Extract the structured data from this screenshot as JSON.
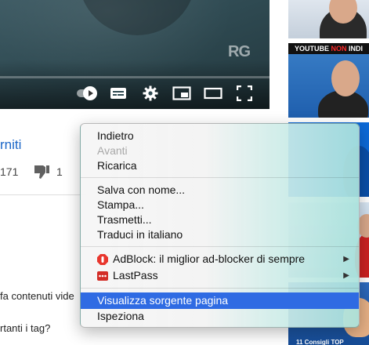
{
  "player": {
    "watermark": "RG",
    "controls": [
      "autoplay-toggle",
      "subtitles-icon",
      "settings-gear-icon",
      "miniplayer-icon",
      "theater-mode-icon",
      "fullscreen-icon"
    ]
  },
  "video": {
    "title_fragment": "rniti",
    "likes": "171",
    "dislikes": "1",
    "description_line1": "fa contenuti vide",
    "description_line2": "rtanti i tag?"
  },
  "sidebar": {
    "thumb2_banner_white1": "YOUTUBE ",
    "thumb2_banner_red": "NON",
    "thumb2_banner_white2": " INDI",
    "thumb5_caption": "11 Consigli TOP"
  },
  "context_menu": {
    "items": [
      {
        "label": "Indietro",
        "enabled": true
      },
      {
        "label": "Avanti",
        "enabled": false
      },
      {
        "label": "Ricarica",
        "enabled": true
      },
      {
        "label": "Salva con nome...",
        "enabled": true
      },
      {
        "label": "Stampa...",
        "enabled": true
      },
      {
        "label": "Trasmetti...",
        "enabled": true
      },
      {
        "label": "Traduci in italiano",
        "enabled": true
      },
      {
        "label": "AdBlock: il miglior ad-blocker di sempre",
        "enabled": true,
        "icon": "adblock-icon",
        "submenu": true
      },
      {
        "label": "LastPass",
        "enabled": true,
        "icon": "lastpass-icon",
        "submenu": true
      },
      {
        "label": "Visualizza sorgente pagina",
        "enabled": true,
        "highlighted": true
      },
      {
        "label": "Ispeziona",
        "enabled": true
      }
    ],
    "colors": {
      "highlight": "#2f6be3",
      "disabled_text": "#a8a8a8",
      "adblock": "#e8362d",
      "lastpass": "#d32d27"
    }
  }
}
